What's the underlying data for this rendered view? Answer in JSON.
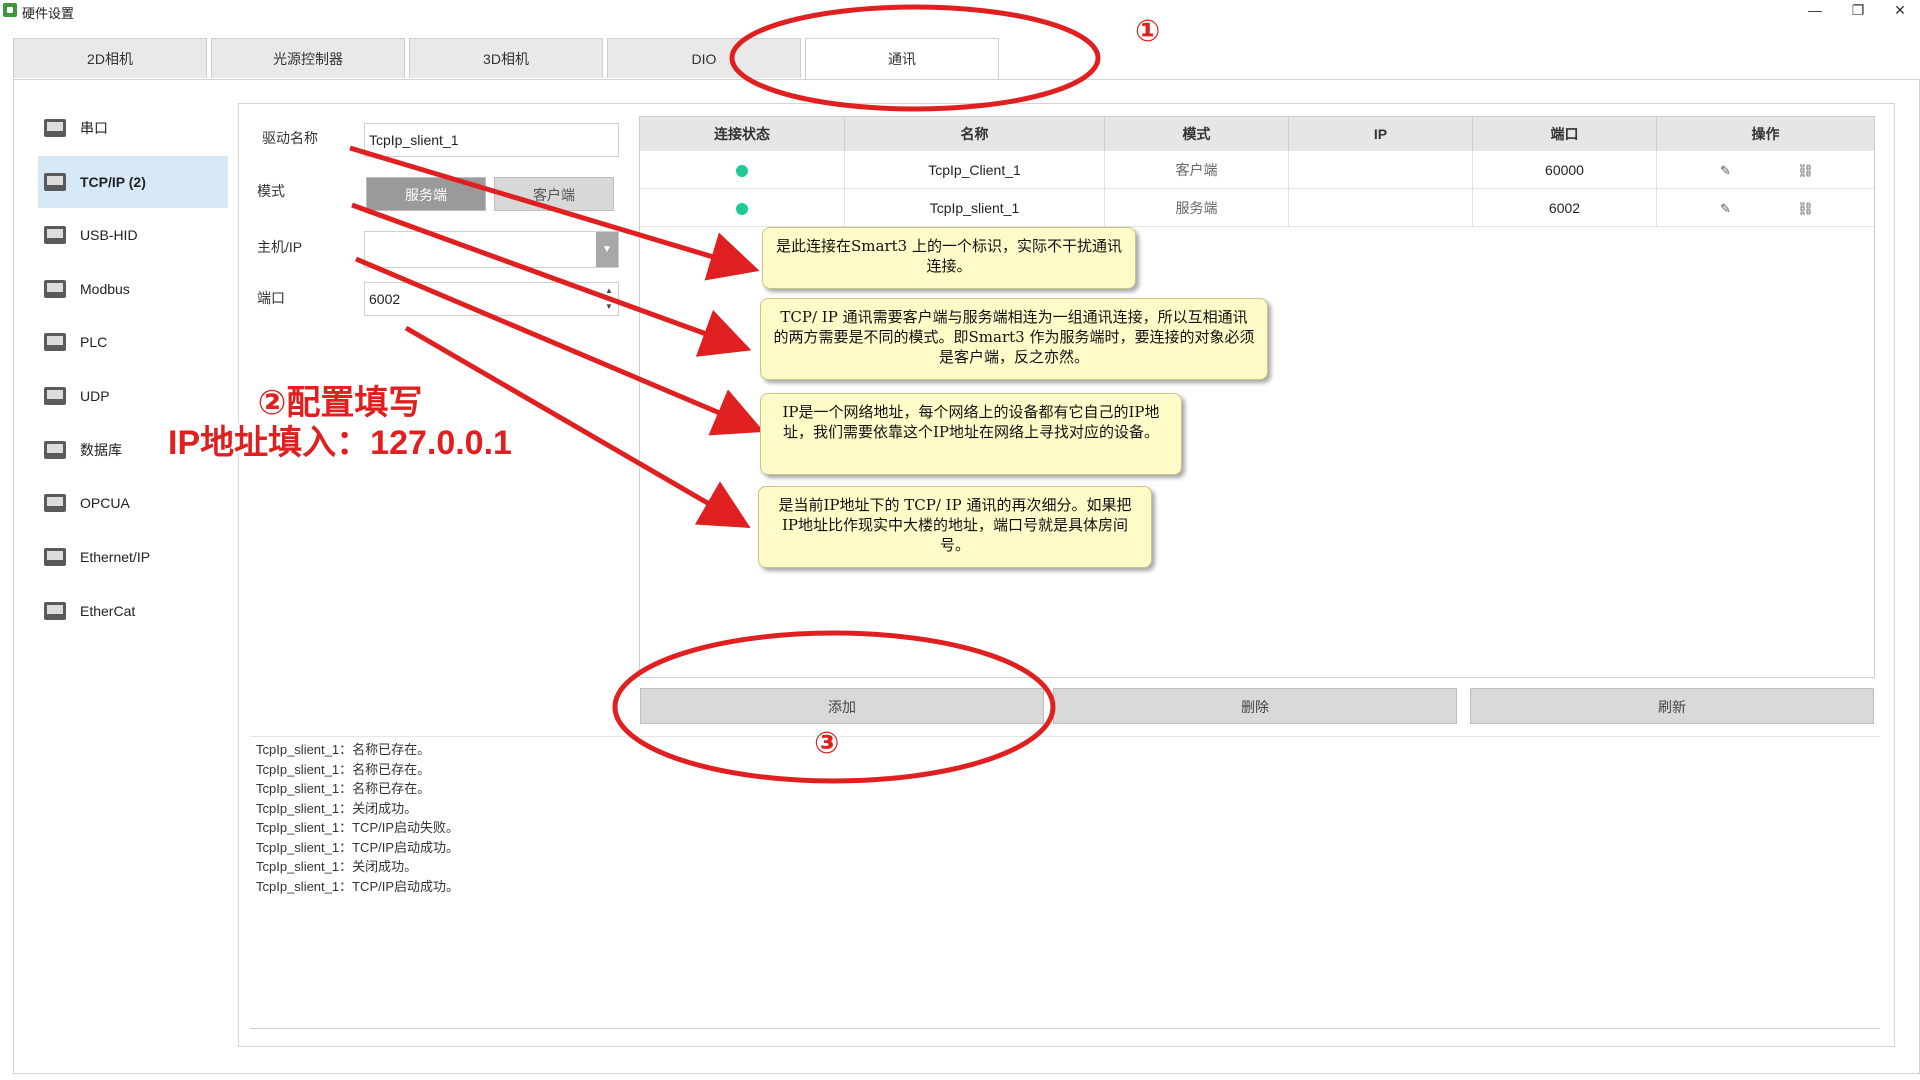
{
  "window": {
    "title": "硬件设置",
    "min": "—",
    "restore": "❐",
    "close": "✕"
  },
  "tabs": [
    {
      "label": "2D相机"
    },
    {
      "label": "光源控制器"
    },
    {
      "label": "3D相机"
    },
    {
      "label": "DIO"
    },
    {
      "label": "通讯",
      "active": true
    }
  ],
  "sidebar": {
    "items": [
      {
        "label": "串口"
      },
      {
        "label": "TCP/IP (2)",
        "active": true
      },
      {
        "label": "USB-HID"
      },
      {
        "label": "Modbus"
      },
      {
        "label": "PLC"
      },
      {
        "label": "UDP"
      },
      {
        "label": "数据库"
      },
      {
        "label": "OPCUA"
      },
      {
        "label": "Ethernet/IP"
      },
      {
        "label": "EtherCat"
      }
    ]
  },
  "form": {
    "name_label": "驱动名称",
    "name_value": "TcpIp_slient_1",
    "mode_label": "模式",
    "mode_server": "服务端",
    "mode_client": "客户端",
    "mode_selected": "服务端",
    "host_label": "主机/IP",
    "host_value": "",
    "port_label": "端口",
    "port_value": "6002"
  },
  "table": {
    "headers": [
      "连接状态",
      "名称",
      "模式",
      "IP",
      "端口",
      "操作"
    ],
    "rows": [
      {
        "status": "connected",
        "name": "TcpIp_Client_1",
        "mode": "客户端",
        "ip": "",
        "port": "60000"
      },
      {
        "status": "connected",
        "name": "TcpIp_slient_1",
        "mode": "服务端",
        "ip": "",
        "port": "6002"
      }
    ],
    "status_color": "#20c997"
  },
  "actions": {
    "add": "添加",
    "delete": "删除",
    "refresh": "刷新"
  },
  "log": [
    "TcpIp_slient_1：名称已存在。",
    "TcpIp_slient_1：名称已存在。",
    "TcpIp_slient_1：名称已存在。",
    "TcpIp_slient_1：关闭成功。",
    "TcpIp_slient_1：TCP/IP启动失败。",
    "TcpIp_slient_1：TCP/IP启动成功。",
    "TcpIp_slient_1：关闭成功。",
    "TcpIp_slient_1：TCP/IP启动成功。"
  ],
  "annotations": {
    "marker1": "①",
    "marker2_line1": "②配置填写",
    "marker2_line2": "IP地址填入：127.0.0.1",
    "marker3": "③",
    "callout_name": "是此连接在Smart3 上的一个标识，实际不干扰通讯连接。",
    "callout_mode": "TCP/ IP 通讯需要客户端与服务端相连为一组通讯连接，所以互相通讯的两方需要是不同的模式。即Smart3 作为服务端时，要连接的对象必须是客户端，反之亦然。",
    "callout_ip": "IP是一个网络地址，每个网络上的设备都有它自己的IP地址，我们需要依靠这个IP地址在网络上寻找对应的设备。",
    "callout_port": "是当前IP地址下的 TCP/ IP 通讯的再次细分。如果把IP地址比作现实中大楼的地址，端口号就是具体房间号。",
    "accent": "#e02020"
  }
}
